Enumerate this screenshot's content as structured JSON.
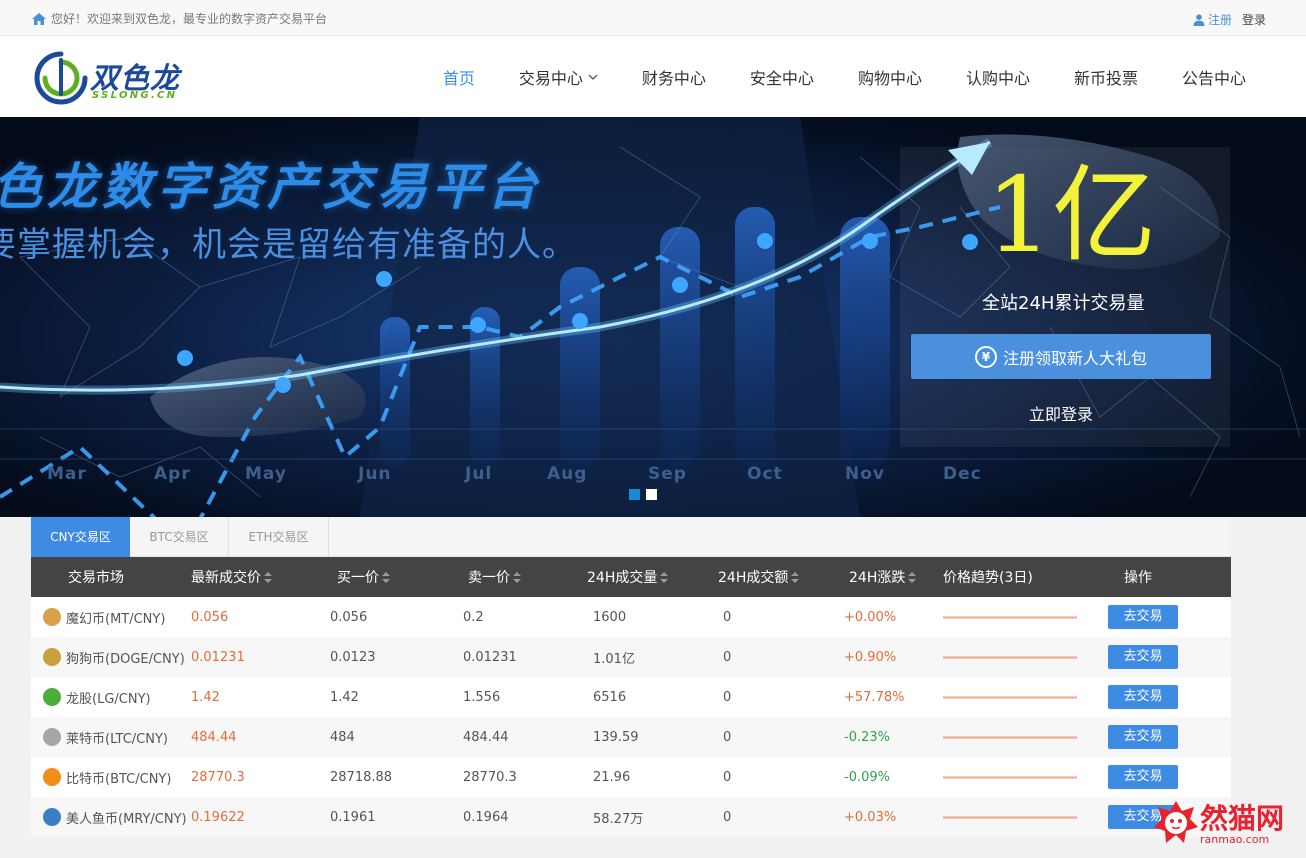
{
  "topbar": {
    "welcome": "您好！欢迎来到双色龙，最专业的数字资产交易平台",
    "register": "注册",
    "login": "登录"
  },
  "logo": {
    "name": "双色龙",
    "domain": "SSLONG.CN"
  },
  "nav": {
    "items": [
      {
        "label": "首页",
        "active": true
      },
      {
        "label": "交易中心",
        "dropdown": true
      },
      {
        "label": "财务中心"
      },
      {
        "label": "安全中心"
      },
      {
        "label": "购物中心"
      },
      {
        "label": "认购中心"
      },
      {
        "label": "新币投票"
      },
      {
        "label": "公告中心"
      }
    ]
  },
  "banner": {
    "headline": "色龙数字资产交易平台",
    "slogan": "要掌握机会，机会是留给有准备的人。",
    "volume": "1亿",
    "volume_label": "全站24H累计交易量",
    "gift_button": "注册领取新人大礼包",
    "gift_icon": "yen-icon",
    "login_now": "立即登录",
    "months": [
      "Mar",
      "Apr",
      "May",
      "Jun",
      "Jul",
      "Aug",
      "Sep",
      "Oct",
      "Nov",
      "Dec"
    ],
    "slides_total": 2,
    "slide_active": 1
  },
  "market": {
    "tabs": [
      {
        "label": "CNY交易区",
        "active": true
      },
      {
        "label": "BTC交易区"
      },
      {
        "label": "ETH交易区"
      }
    ],
    "columns": [
      "交易市场",
      "最新成交价",
      "买一价",
      "卖一价",
      "24H成交量",
      "24H成交额",
      "24H涨跌",
      "价格趋势(3日)",
      "操作"
    ],
    "rows": [
      {
        "market": "魔幻币(MT/CNY)",
        "latest": "0.056",
        "buy": "0.056",
        "sell": "0.2",
        "volume": "1600",
        "amount": "0",
        "change": "+0.00%",
        "up": true,
        "icon_color": "#d8a24a",
        "action": "去交易"
      },
      {
        "market": "狗狗币(DOGE/CNY)",
        "latest": "0.01231",
        "buy": "0.0123",
        "sell": "0.01231",
        "volume": "1.01亿",
        "amount": "0",
        "change": "+0.90%",
        "up": true,
        "icon_color": "#c9a13b",
        "action": "去交易"
      },
      {
        "market": "龙股(LG/CNY)",
        "latest": "1.42",
        "buy": "1.42",
        "sell": "1.556",
        "volume": "6516",
        "amount": "0",
        "change": "+57.78%",
        "up": true,
        "icon_color": "#4cae3a",
        "action": "去交易"
      },
      {
        "market": "莱特币(LTC/CNY)",
        "latest": "484.44",
        "buy": "484",
        "sell": "484.44",
        "volume": "139.59",
        "amount": "0",
        "change": "-0.23%",
        "up": false,
        "icon_color": "#a6a6a6",
        "action": "去交易"
      },
      {
        "market": "比特币(BTC/CNY)",
        "latest": "28770.3",
        "buy": "28718.88",
        "sell": "28770.3",
        "volume": "21.96",
        "amount": "0",
        "change": "-0.09%",
        "up": false,
        "icon_color": "#f28c1a",
        "action": "去交易"
      },
      {
        "market": "美人鱼币(MRY/CNY)",
        "latest": "0.19622",
        "buy": "0.1961",
        "sell": "0.1964",
        "volume": "58.27万",
        "amount": "0",
        "change": "+0.03%",
        "up": true,
        "icon_color": "#3a7fc4",
        "action": "去交易"
      }
    ]
  },
  "watermark": {
    "text": "然猫网",
    "sub": "ranmao.com"
  }
}
